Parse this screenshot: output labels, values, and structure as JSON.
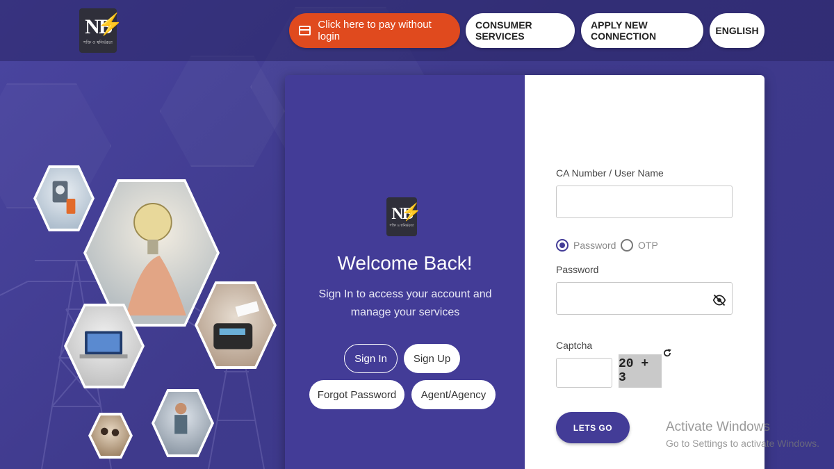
{
  "brand": {
    "logo_text": "NB",
    "logo_tagline": "শক্তি ও স্বনির্ভরতা"
  },
  "header": {
    "pay_button": "Click here to pay without login",
    "consumer_services": "CONSUMER SERVICES",
    "apply_connection": "APPLY NEW CONNECTION",
    "language": "ENGLISH"
  },
  "welcome_panel": {
    "title": "Welcome Back!",
    "subtitle": "Sign In to access your account and manage your services",
    "buttons": {
      "sign_in": "Sign In",
      "sign_up": "Sign Up",
      "forgot_password": "Forgot Password",
      "agent": "Agent/Agency"
    }
  },
  "login_form": {
    "user_label": "CA Number / User Name",
    "user_value": "",
    "auth_options": [
      "Password",
      "OTP"
    ],
    "auth_selected": "Password",
    "password_label": "Password",
    "password_value": "",
    "captcha_label": "Captcha",
    "captcha_value": "",
    "captcha_question": "20 + 3",
    "submit": "LETS GO"
  },
  "watermark": {
    "line1": "Activate Windows",
    "line2": "Go to Settings to activate Windows."
  },
  "colors": {
    "primary": "#433c97",
    "accent": "#e04a1e",
    "background": "#3f3a8c"
  },
  "icons": [
    "card-icon",
    "eye-off-icon",
    "refresh-icon",
    "bolt-icon"
  ]
}
